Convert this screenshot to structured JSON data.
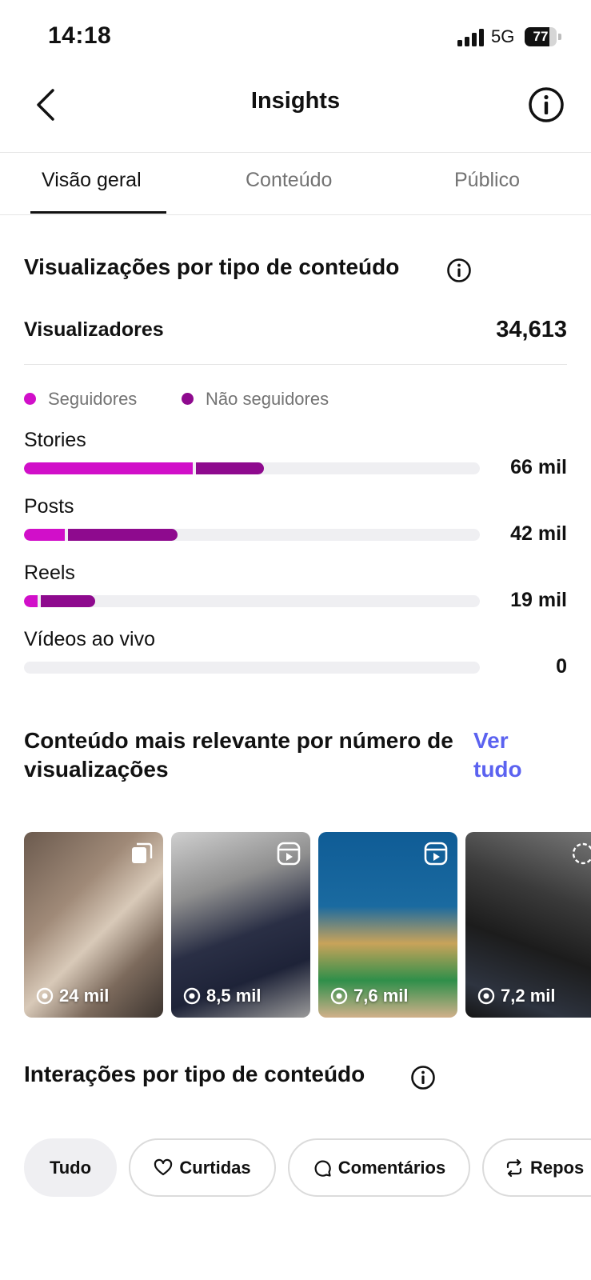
{
  "status_bar": {
    "time": "14:18",
    "network": "5G",
    "battery": "77",
    "battery_level": 0.77
  },
  "header": {
    "title": "Insights"
  },
  "tabs": [
    {
      "label": "Visão geral",
      "active": true
    },
    {
      "label": "Conteúdo",
      "active": false
    },
    {
      "label": "Público",
      "active": false
    }
  ],
  "views_section": {
    "title": "Visualizações por tipo de conteúdo",
    "viewers_label": "Visualizadores",
    "viewers_value": "34,613",
    "legend": [
      {
        "label": "Seguidores",
        "color": "#d10fc9"
      },
      {
        "label": "Não seguidores",
        "color": "#8e0a8e"
      }
    ],
    "rows": [
      {
        "label": "Stories",
        "value": "66 mil",
        "followers_frac": 0.37,
        "non_followers_frac": 0.15
      },
      {
        "label": "Posts",
        "value": "42 mil",
        "followers_frac": 0.09,
        "non_followers_frac": 0.24
      },
      {
        "label": "Reels",
        "value": "19 mil",
        "followers_frac": 0.03,
        "non_followers_frac": 0.12
      },
      {
        "label": "Vídeos ao vivo",
        "value": "0",
        "followers_frac": 0,
        "non_followers_frac": 0
      }
    ]
  },
  "top_content": {
    "title": "Conteúdo mais relevante por número de visualizações",
    "see_all": "Ver tudo",
    "items": [
      {
        "views": "24 mil",
        "type_icon": "carousel-icon"
      },
      {
        "views": "8,5 mil",
        "type_icon": "reels-icon"
      },
      {
        "views": "7,6 mil",
        "type_icon": "reels-icon"
      },
      {
        "views": "7,2 mil",
        "type_icon": "story-icon"
      }
    ]
  },
  "interactions_section": {
    "title": "Interações por tipo de conteúdo",
    "chips": [
      {
        "label": "Tudo",
        "icon": "",
        "active": true
      },
      {
        "label": "Curtidas",
        "icon": "heart-icon",
        "active": false
      },
      {
        "label": "Comentários",
        "icon": "comment-icon",
        "active": false
      },
      {
        "label": "Repos",
        "icon": "repost-icon",
        "active": false
      }
    ]
  },
  "colors": {
    "followers": "#d10fc9",
    "non_followers": "#8e0a8e",
    "link": "#5b62f0"
  }
}
